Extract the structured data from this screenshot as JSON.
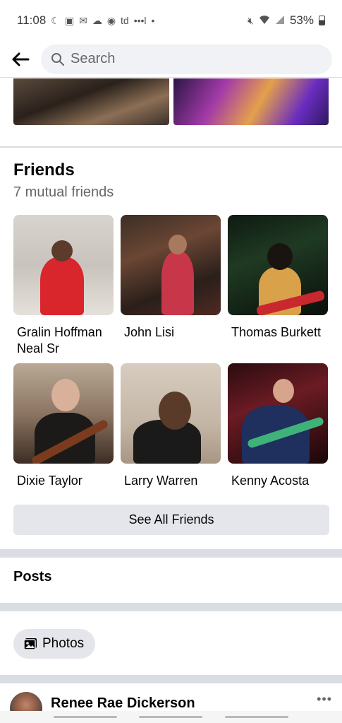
{
  "status_bar": {
    "time": "11:08",
    "carrier_text": "td",
    "battery": "53%"
  },
  "search": {
    "placeholder": "Search"
  },
  "friends": {
    "title": "Friends",
    "mutual": "7 mutual friends",
    "items": [
      {
        "name": "Gralin Hoffman Neal Sr"
      },
      {
        "name": "John Lisi"
      },
      {
        "name": "Thomas Burkett"
      },
      {
        "name": "Dixie Taylor"
      },
      {
        "name": "Larry Warren"
      },
      {
        "name": "Kenny Acosta"
      }
    ],
    "see_all_label": "See All Friends"
  },
  "posts": {
    "title": "Posts",
    "photos_chip_label": "Photos",
    "author": "Renee Rae Dickerson",
    "more_label": "•••"
  },
  "colors": {
    "accent_bg": "#e4e6eb",
    "secondary_text": "#65676b",
    "divider": "#dadde1"
  }
}
